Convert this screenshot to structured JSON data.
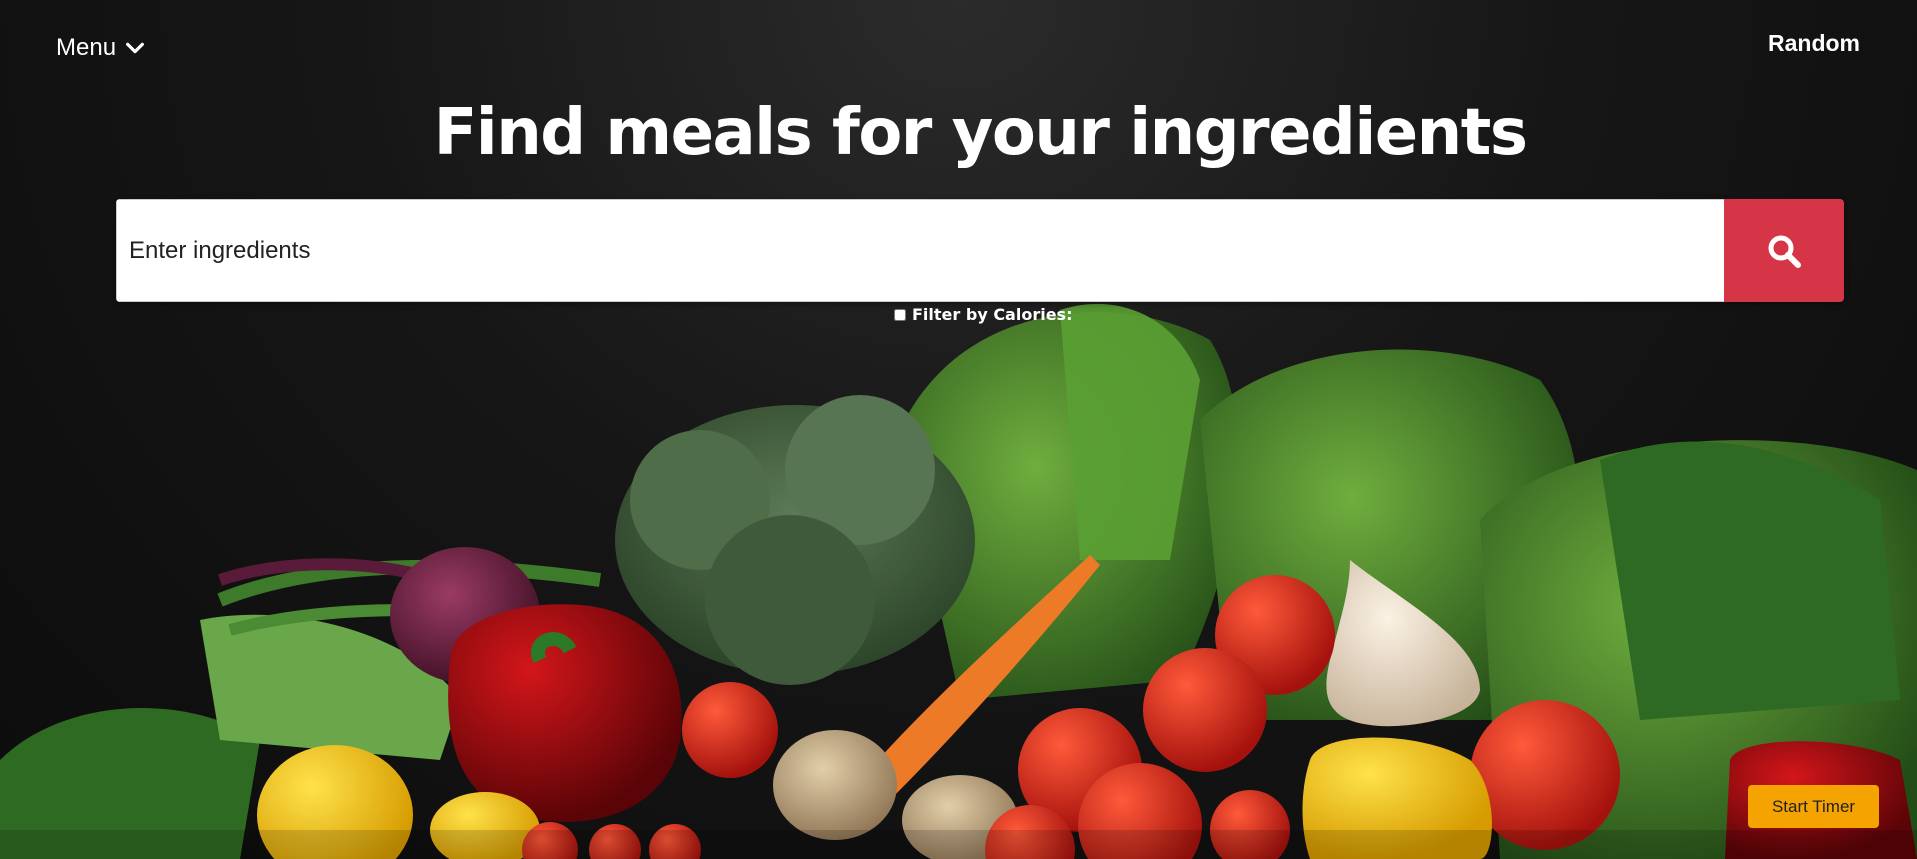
{
  "nav": {
    "menu_label": "Menu",
    "random_label": "Random"
  },
  "hero": {
    "title": "Find meals for your ingredients",
    "background_image": "vegetables-on-dark-background"
  },
  "search": {
    "placeholder": "Enter ingredients",
    "button_icon": "search-icon"
  },
  "filter": {
    "label": "Filter by Calories:",
    "checked": false
  },
  "timer": {
    "label": "Start Timer"
  },
  "colors": {
    "search_button": "#d63447",
    "timer_button": "#f5a300"
  }
}
